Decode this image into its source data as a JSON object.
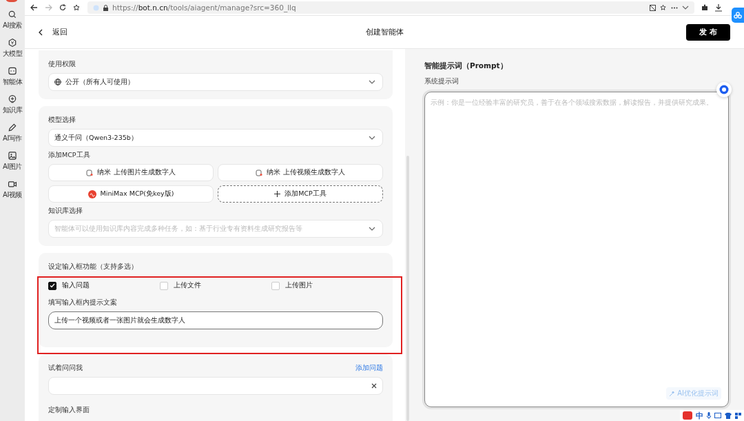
{
  "browser": {
    "url": "https://**bot.n.cn**/tools/aiagent/manage?src=360_llq"
  },
  "sidebar": {
    "items": [
      {
        "label": "AI搜索"
      },
      {
        "label": "大模型"
      },
      {
        "label": "智能体"
      },
      {
        "label": "知识库"
      },
      {
        "label": "AI写作"
      },
      {
        "label": "AI图片"
      },
      {
        "label": "AI视频"
      }
    ]
  },
  "header": {
    "back": "返回",
    "title": "创建智能体",
    "publish": "发 布"
  },
  "permission": {
    "label": "使用权限",
    "value": "公开（所有人可使用）"
  },
  "model": {
    "label": "模型选择",
    "value": "通义千问（Qwen3-235b）"
  },
  "mcp": {
    "label": "添加MCP工具",
    "tools": [
      {
        "kind": "nami",
        "label": "纳米 上传图片生成数字人"
      },
      {
        "kind": "nami",
        "label": "纳米 上传视频生成数字人"
      },
      {
        "kind": "minimax",
        "label": "MiniMax MCP(免key版)"
      },
      {
        "kind": "add",
        "label": "添加MCP工具"
      }
    ]
  },
  "knowledge": {
    "label": "知识库选择",
    "placeholder": "智能体可以使用知识库内容完成多种任务，如：基于行业专有资料生成研究报告等"
  },
  "input_settings": {
    "highlighted": true,
    "label": "设定输入框功能（支持多选）",
    "options": [
      {
        "label": "输入问题",
        "checked": true
      },
      {
        "label": "上传文件",
        "checked": false
      },
      {
        "label": "上传图片",
        "checked": false
      }
    ],
    "hint_label": "填写输入框内提示文案",
    "hint_value": "上传一个视频或者一张图片就会生成数字人"
  },
  "try_ask": {
    "label": "试着问问我",
    "add": "添加问题"
  },
  "custom_input": {
    "label": "定制输入界面"
  },
  "prompt": {
    "title": "智能提示词（Prompt）",
    "label": "系统提示词",
    "placeholder": "示例：你是一位经验丰富的研究员，善于在各个领域搜索数据，解读报告，并提供研究成果。",
    "optimize": "AI优化提示词"
  },
  "ime": {
    "mode": "中"
  }
}
